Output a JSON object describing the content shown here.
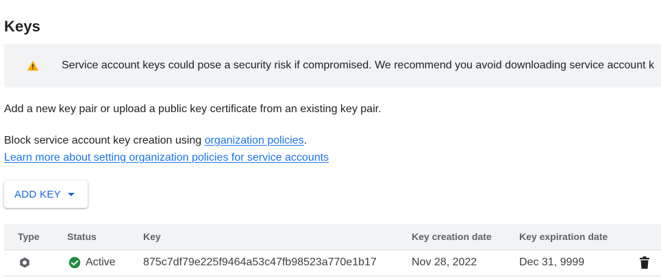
{
  "title": "Keys",
  "banner": {
    "icon": "warning-icon",
    "icon_color": "#f9ab00",
    "text": "Service account keys could pose a security risk if compromised. We recommend you avoid downloading service account k"
  },
  "intro": "Add a new key pair or upload a public key certificate from an existing key pair.",
  "block": {
    "prefix": "Block service account key creation using ",
    "link": "organization policies",
    "suffix": "."
  },
  "learn_more": "Learn more about setting organization policies for service accounts",
  "add_key": {
    "label": "ADD KEY",
    "icon": "dropdown-caret-icon"
  },
  "table": {
    "columns": {
      "type": "Type",
      "status": "Status",
      "key": "Key",
      "created": "Key creation date",
      "expires": "Key expiration date"
    },
    "rows": [
      {
        "type_icon": "service-account-key-icon",
        "status": "Active",
        "status_icon": "check-circle-icon",
        "status_color": "#1e8e3e",
        "key": "875c7df79e225f9464a53c47fb98523a770e1b17",
        "created": "Nov 28, 2022",
        "expires": "Dec 31, 9999",
        "action_icon": "delete-icon"
      }
    ]
  },
  "colors": {
    "link": "#1a73e8",
    "button_text": "#1967d2",
    "banner_bg": "#f1f3f4",
    "header_bg": "#f1f3f4"
  }
}
